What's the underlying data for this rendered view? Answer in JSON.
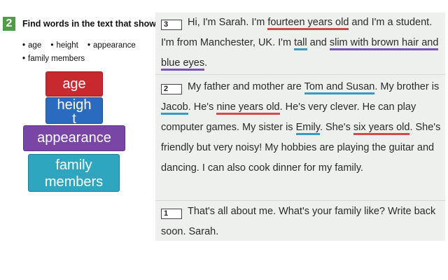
{
  "task": {
    "number": "2",
    "instruction": "Find words in the text that show:",
    "bullets": [
      "age",
      "height",
      "appearance",
      "family members"
    ]
  },
  "tags": {
    "age": "age",
    "height_line1": "heigh",
    "height_line2": "t",
    "appearance": "appearance",
    "family_line1": "family",
    "family_line2": "members"
  },
  "colors": {
    "age": "#c8292e",
    "height": "#2b6bbf",
    "appearance": "#7a46a6",
    "family": "#2fa6c0",
    "task_number": "#4f9e45"
  },
  "paragraphs": {
    "p3": {
      "number": "3",
      "t1": "Hi, I'm Sarah. I'm ",
      "age": "fourteen years old",
      "t2": " and I'm a student. I'm from Manchester, UK. I'm ",
      "height": "tall",
      "t3": " and ",
      "appearance1": "slim with brown hair and blue eyes",
      "t4": "."
    },
    "p2": {
      "number": "2",
      "t1": "My father and mother are ",
      "family1": "Tom and Susan",
      "t2": ". My brother is ",
      "family2": "Jacob",
      "t3": ". He's ",
      "age1": "nine years old",
      "t4": ". He's very clever. He can play computer games. My sister is ",
      "family3": "Emily",
      "t5": ". She's ",
      "age2": "six years old",
      "t6": ". She's friendly but very noisy! My hobbies are playing the guitar and dancing. I can also cook dinner for my family."
    },
    "p1": {
      "number": "1",
      "text": "That's all about me. What's your family like? Write back soon. Sarah."
    }
  }
}
